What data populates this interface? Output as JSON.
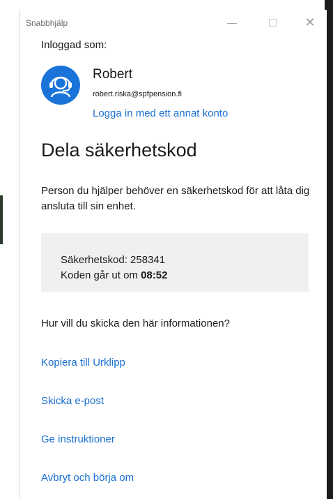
{
  "window": {
    "title": "Snabbhjälp",
    "minimize_glyph": "—",
    "close_glyph": "✕"
  },
  "account": {
    "signed_in_label": "Inloggad som:",
    "name": "Robert",
    "email": "robert.riska@spfpension.fi",
    "switch_account_link": "Logga in med ett annat konto",
    "avatar_icon": "headset-person-icon",
    "avatar_color": "#1a73d9"
  },
  "main": {
    "heading": "Dela säkerhetskod",
    "description": "Person du hjälper behöver en säkerhetskod för att låta dig ansluta till sin enhet.",
    "code_label": "Säkerhetskod: 258341",
    "expires_prefix": "Koden går ut om ",
    "expires_time": "08:52"
  },
  "share": {
    "question": "Hur vill du skicka den här informationen?",
    "copy_link": "Kopiera till Urklipp",
    "email_link": "Skicka e-post",
    "instructions_link": "Ge instruktioner",
    "cancel_link": "Avbryt och börja om"
  },
  "colors": {
    "link": "#1a6fd1",
    "code_box_bg": "#f0f0f0"
  }
}
